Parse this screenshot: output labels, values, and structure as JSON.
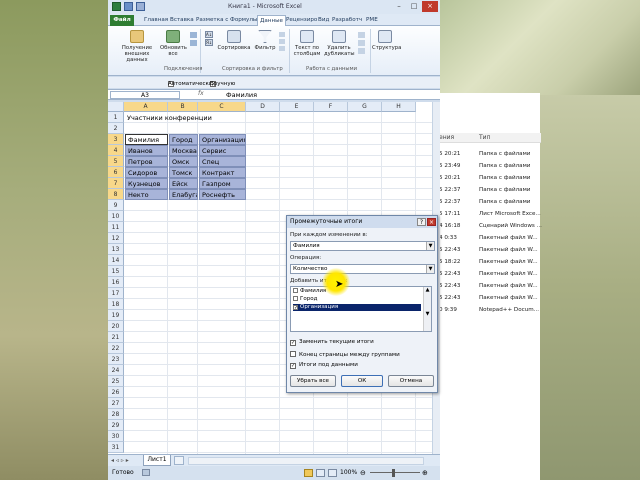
{
  "window": {
    "title": "Книга1 - Microsoft Excel"
  },
  "tabs": [
    "Файл",
    "Главная",
    "Вставка",
    "Разметка с",
    "Формулы",
    "Данные",
    "Рецензиро",
    "Вид",
    "Разработч",
    "PME"
  ],
  "ribbon": {
    "get_external": "Получение внешних данных",
    "refresh_all": "Обновить все",
    "sort": "Сортировка",
    "filter": "Фильтр",
    "text_to_columns": "Текст по столбцам",
    "remove_duplicates": "Удалить дубликаты",
    "structure": "Структура",
    "group_connections": "Подключения",
    "group_sort_filter": "Сортировка и фильтр",
    "group_data_tools": "Работа с данными"
  },
  "options_bar": {
    "automatic": "Автоматически",
    "manual": "Вручную"
  },
  "formula_bar": {
    "name_box": "A3",
    "fx": "fx",
    "value": "Фамилия"
  },
  "columns": [
    "A",
    "B",
    "C",
    "D",
    "E",
    "F",
    "G",
    "H"
  ],
  "rows": [
    "1",
    "2",
    "3",
    "4",
    "5",
    "6",
    "7",
    "8",
    "9",
    "10",
    "11",
    "12",
    "13",
    "14",
    "15",
    "16",
    "17",
    "18",
    "19",
    "20",
    "21",
    "22",
    "23",
    "24",
    "25",
    "26",
    "27",
    "28",
    "29",
    "30",
    "31"
  ],
  "sheet": {
    "title": "Участники конференции",
    "headers": [
      "Фамилия",
      "Город",
      "Организация"
    ],
    "data": [
      [
        "Иванов",
        "Москва",
        "Сервис"
      ],
      [
        "Петров",
        "Омск",
        "Спец"
      ],
      [
        "Сидоров",
        "Томск",
        "Контракт"
      ],
      [
        "Кузнецов",
        "Ейск",
        "Газпром"
      ],
      [
        "Некто",
        "Елабуга",
        "Роснефть"
      ]
    ]
  },
  "sheet_tab": "Лист1",
  "status": {
    "ready": "Готово",
    "zoom": "100%"
  },
  "dialog": {
    "title": "Промежуточные итоги",
    "at_each_change_label": "При каждом изменении в:",
    "at_each_change_value": "Фамилия",
    "operation_label": "Операция:",
    "operation_value": "Количество",
    "add_totals_label": "Добавить итоги по:",
    "fields": [
      {
        "label": "Фамилия",
        "checked": false
      },
      {
        "label": "Город",
        "checked": false
      },
      {
        "label": "Организация",
        "checked": true
      }
    ],
    "replace_current": "Заменить текущие итоги",
    "page_break": "Конец страницы между группами",
    "summary_below": "Итоги под данными",
    "remove_all": "Убрать все",
    "ok": "ОК",
    "cancel": "Отмена"
  },
  "explorer": {
    "col_date": "ения",
    "col_type": "Тип",
    "rows": [
      {
        "time": "5 20:21",
        "type": "Папка с файлами"
      },
      {
        "time": "5 23:49",
        "type": "Папка с файлами"
      },
      {
        "time": "5 20:21",
        "type": "Папка с файлами"
      },
      {
        "time": "5 22:37",
        "type": "Папка с файлами"
      },
      {
        "time": "5 22:37",
        "type": "Папка с файлами"
      },
      {
        "time": "5 17:11",
        "type": "Лист Microsoft Exce..."
      },
      {
        "time": "4 16:18",
        "type": "Сценарий Windows ..."
      },
      {
        "time": "4 0:33",
        "type": "Пакетный файл W..."
      },
      {
        "time": "5 22:43",
        "type": "Пакетный файл W..."
      },
      {
        "time": "5 18:22",
        "type": "Пакетный файл W..."
      },
      {
        "time": "5 22:43",
        "type": "Пакетный файл W..."
      },
      {
        "time": "5 22:43",
        "type": "Пакетный файл W..."
      },
      {
        "time": "5 22:43",
        "type": "Пакетный файл W..."
      },
      {
        "time": "0 9:39",
        "type": "Notepad++ Docum..."
      }
    ]
  }
}
